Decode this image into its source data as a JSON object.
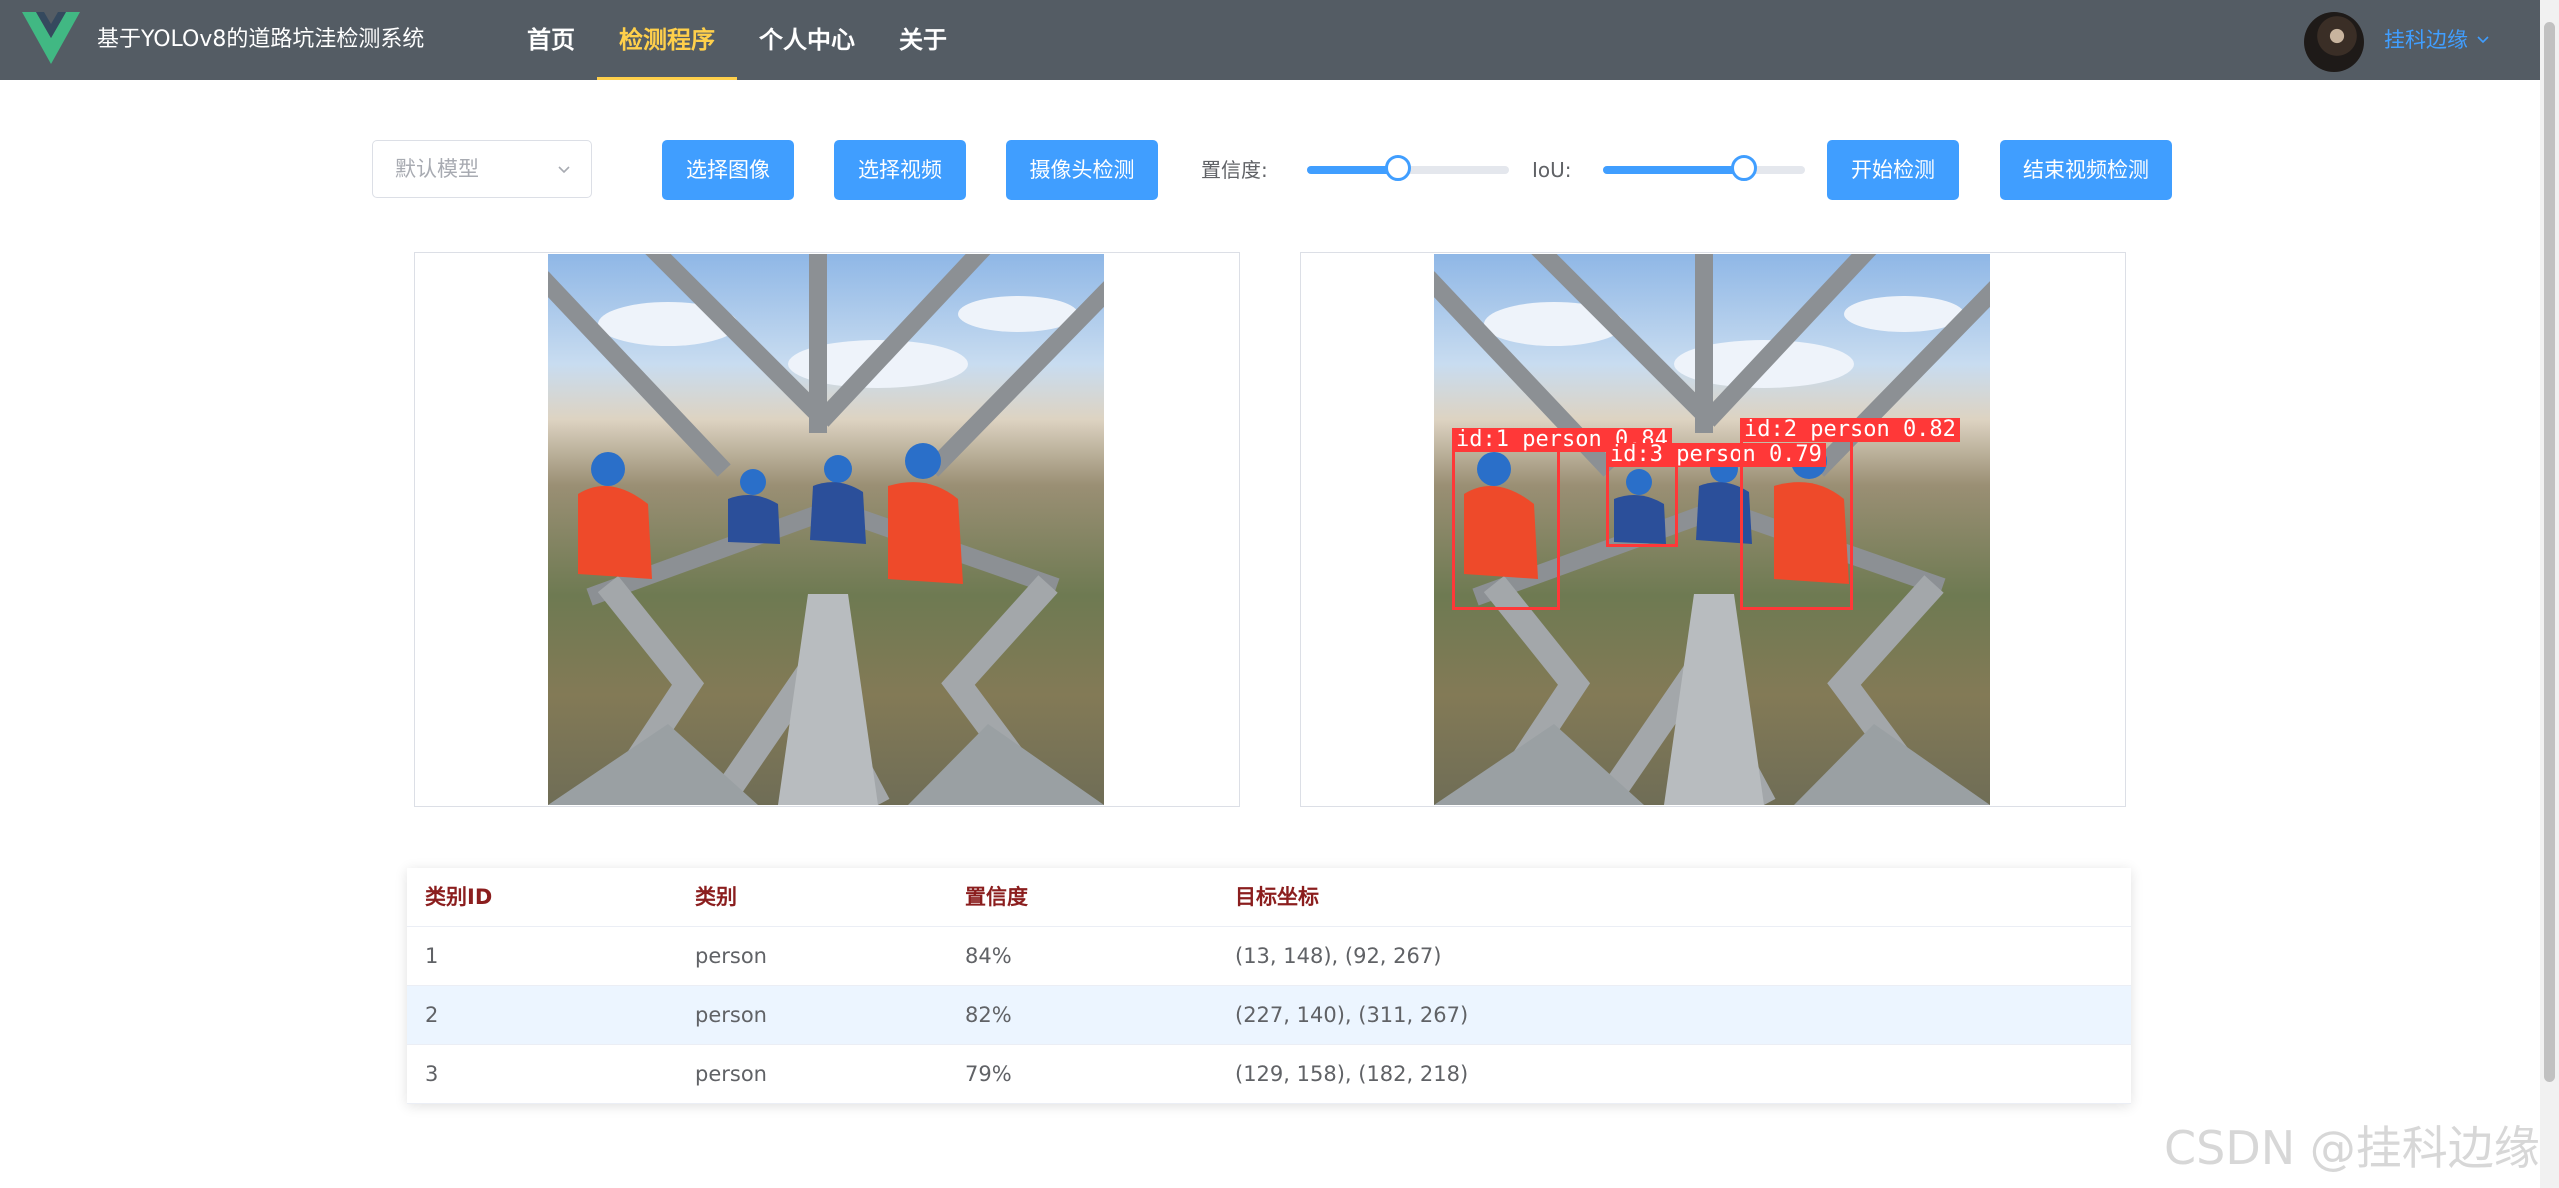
{
  "header": {
    "app_title": "基于YOLOv8的道路坑洼检测系统",
    "nav": [
      {
        "label": "首页",
        "active": false
      },
      {
        "label": "检测程序",
        "active": true
      },
      {
        "label": "个人中心",
        "active": false
      },
      {
        "label": "关于",
        "active": false
      }
    ],
    "username": "挂科边缘",
    "colors": {
      "bg": "#545c64",
      "active": "#ffd04b",
      "user": "#409eff"
    }
  },
  "toolbar": {
    "model_select": {
      "placeholder": "默认模型"
    },
    "select_image": "选择图像",
    "select_video": "选择视频",
    "camera_detect": "摄像头检测",
    "confidence_label": "置信度:",
    "confidence_value": 0.45,
    "iou_label": "IoU:",
    "iou_value": 0.7,
    "start_detect": "开始检测",
    "stop_video_detect": "结束视频检测"
  },
  "results": {
    "headers": [
      "类别ID",
      "类别",
      "置信度",
      "目标坐标"
    ],
    "rows": [
      [
        "1",
        "person",
        "84%",
        "(13, 148), (92, 267)"
      ],
      [
        "2",
        "person",
        "82%",
        "(227, 140), (311, 267)"
      ],
      [
        "3",
        "person",
        "79%",
        "(129, 158), (182, 218)"
      ]
    ]
  },
  "detections": [
    {
      "label": "id:1 person 0.84"
    },
    {
      "label": "id:2 person 0.82"
    },
    {
      "label": "id:3 person 0.79"
    }
  ],
  "watermark": "CSDN @挂科边缘"
}
